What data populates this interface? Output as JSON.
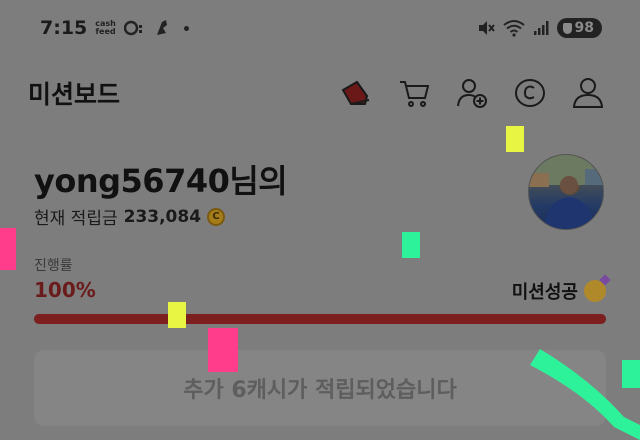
{
  "status_bar": {
    "time": "7:15",
    "app_badge_line1": "cash",
    "app_badge_line2": "feed",
    "battery": "98",
    "icons": [
      "cashfeed-app-icon",
      "dnd-icon",
      "bird-icon",
      "mute-icon",
      "wifi-icon",
      "signal-icon",
      "battery-icon"
    ]
  },
  "header": {
    "title": "미션보드",
    "icons": [
      "sneaker-icon",
      "cart-icon",
      "add-friend-icon",
      "coin-c-icon",
      "profile-icon"
    ]
  },
  "user": {
    "username": "yong56740님의",
    "points_label": "현재 적립금",
    "points_value": "233,084",
    "coin_symbol": "C"
  },
  "progress": {
    "label": "진행률",
    "percent_text": "100%",
    "percent": 100,
    "status_text": "미션성공"
  },
  "notice": {
    "text": "추가 6캐시가 적립되었습니다"
  },
  "colors": {
    "overlay_bg": "#7d7d7d",
    "progress_fill": "#7d1f1f",
    "confetti_pink": "#ff3d8b",
    "confetti_yellow": "#e8f542",
    "confetti_green": "#2ef29a"
  }
}
